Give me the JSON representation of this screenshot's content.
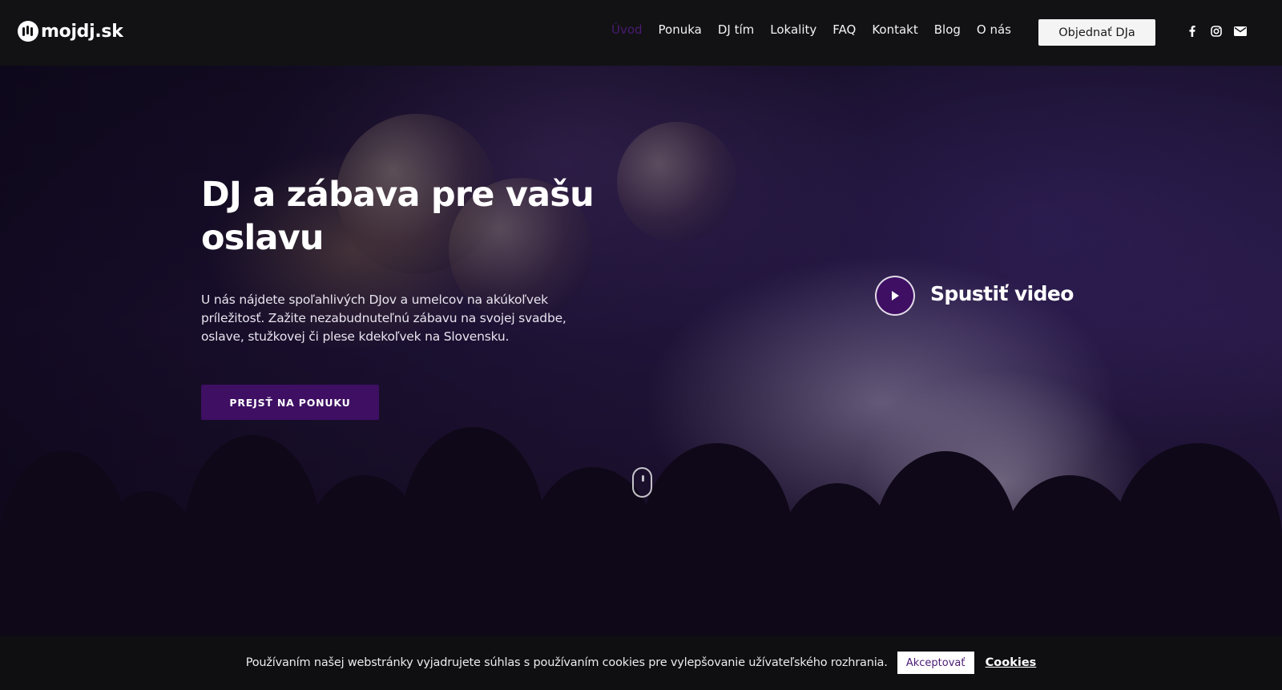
{
  "header": {
    "logo_text": "mojdj.sk",
    "nav": [
      {
        "label": "Úvod",
        "active": true
      },
      {
        "label": "Ponuka"
      },
      {
        "label": "DJ tím"
      },
      {
        "label": "Lokality"
      },
      {
        "label": "FAQ"
      },
      {
        "label": "Kontakt"
      },
      {
        "label": "Blog"
      },
      {
        "label": "O nás"
      }
    ],
    "cta_label": "Objednať DJa",
    "social_icons": [
      "facebook-icon",
      "instagram-icon",
      "envelope-icon"
    ]
  },
  "hero": {
    "title": "DJ a zábava pre vašu oslavu",
    "text": "U nás nájdete spoľahlivých DJov a umelcov na akúkoľvek príležitosť. Zažite nezabudnuteľnú zábavu na svojej svadbe, oslave, stužkovej či plese kdekoľvek na Slovensku.",
    "button_label": "PREJSŤ NA PONUKU",
    "video_label": "Spustiť video"
  },
  "cookie_bar": {
    "text": "Používaním našej webstránky vyjadrujete súhlas s používaním cookies pre vylepšovanie užívateľského rozhrania.",
    "accept_label": "Akceptovať",
    "link_label": "Cookies"
  },
  "colors": {
    "brand_purple": "#3e0f63",
    "active_nav": "#4a1b73",
    "header_bg": "#121214"
  }
}
